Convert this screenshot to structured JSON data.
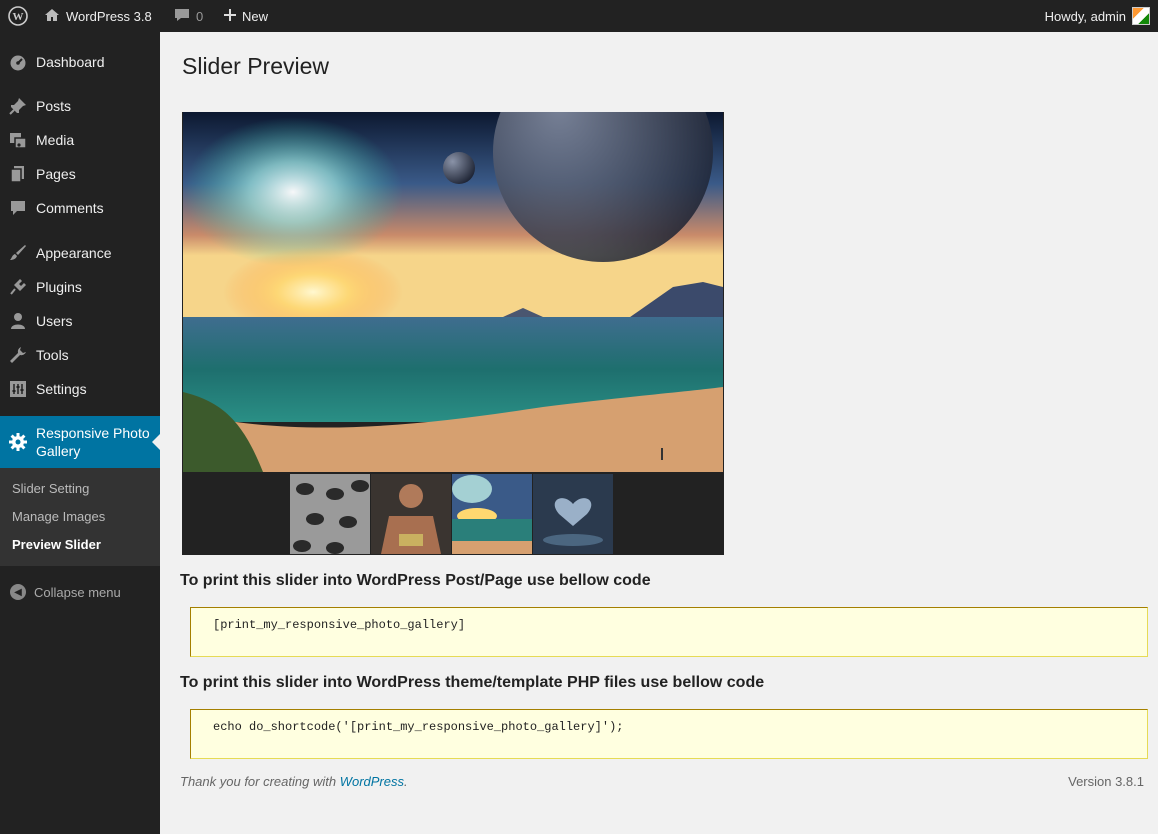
{
  "adminbar": {
    "site_name": "WordPress 3.8",
    "comments_count": "0",
    "new_label": "New",
    "howdy": "Howdy, admin"
  },
  "sidebar": {
    "items": [
      {
        "label": "Dashboard",
        "icon": "dashboard-icon"
      },
      {
        "label": "Posts",
        "icon": "pin-icon"
      },
      {
        "label": "Media",
        "icon": "media-icon"
      },
      {
        "label": "Pages",
        "icon": "pages-icon"
      },
      {
        "label": "Comments",
        "icon": "comment-icon"
      },
      {
        "label": "Appearance",
        "icon": "brush-icon"
      },
      {
        "label": "Plugins",
        "icon": "plugin-icon"
      },
      {
        "label": "Users",
        "icon": "user-icon"
      },
      {
        "label": "Tools",
        "icon": "wrench-icon"
      },
      {
        "label": "Settings",
        "icon": "settings-icon"
      },
      {
        "label": "Responsive Photo Gallery",
        "icon": "gear-icon"
      }
    ],
    "submenu": [
      {
        "label": "Slider Setting"
      },
      {
        "label": "Manage Images"
      },
      {
        "label": "Preview Slider"
      }
    ],
    "collapse_label": "Collapse menu"
  },
  "main": {
    "title": "Slider Preview",
    "heading_post": "To print this slider into WordPress Post/Page use bellow code",
    "code_post": "[print_my_responsive_photo_gallery]",
    "heading_theme": "To print this slider into WordPress theme/template PHP files use bellow code",
    "code_theme": "echo do_shortcode('[print_my_responsive_photo_gallery]');"
  },
  "footer": {
    "thanks_prefix": "Thank you for creating with ",
    "thanks_link": "WordPress",
    "thanks_suffix": ".",
    "version": "Version 3.8.1"
  },
  "colors": {
    "accent": "#0074a2",
    "menu_bg": "#222222",
    "code_bg": "#ffffe0"
  }
}
